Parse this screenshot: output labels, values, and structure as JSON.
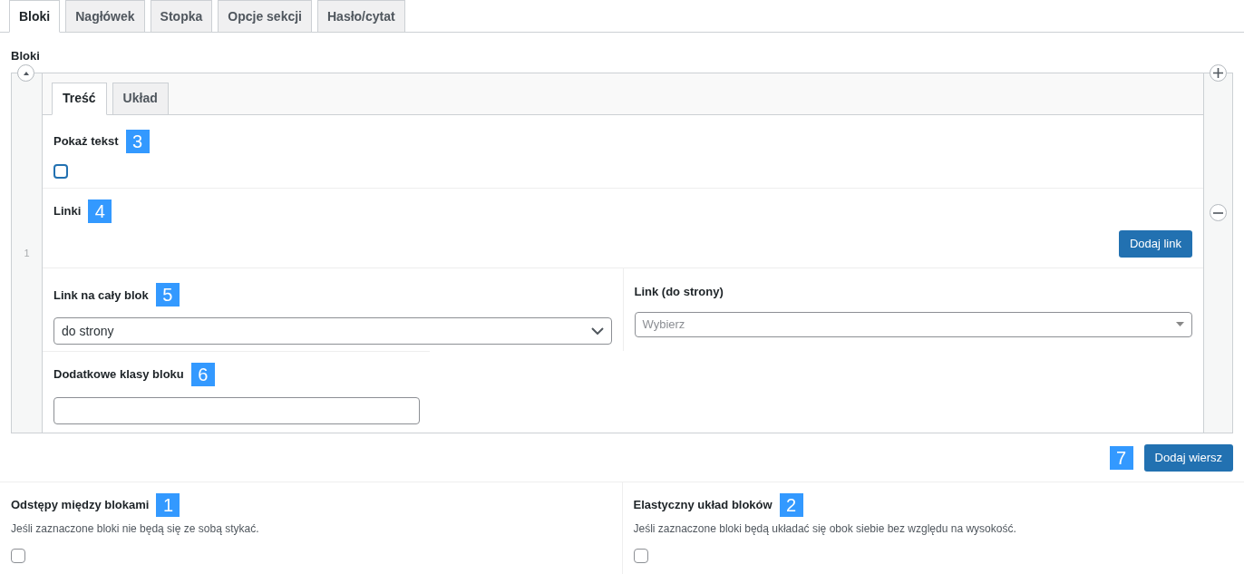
{
  "tabs": [
    {
      "label": "Bloki",
      "selected": true
    },
    {
      "label": "Nagłówek",
      "selected": false
    },
    {
      "label": "Stopka",
      "selected": false
    },
    {
      "label": "Opcje sekcji",
      "selected": false
    },
    {
      "label": "Hasło/cytat",
      "selected": false
    }
  ],
  "section_label": "Bloki",
  "repeater": {
    "row_number": "1",
    "tabs": [
      {
        "label": "Treść",
        "selected": true
      },
      {
        "label": "Układ",
        "selected": false
      }
    ],
    "fields": [
      {
        "kind": "checkbox",
        "label": "Pokaż tekst",
        "marker": "3",
        "checked": false
      },
      {
        "kind": "links",
        "label": "Linki",
        "marker": "4",
        "button": "Dodaj link"
      },
      {
        "kind": "pair",
        "columns": [
          {
            "kind": "select",
            "label": "Link na cały blok",
            "marker": "5",
            "value": "do strony"
          },
          {
            "kind": "combobox",
            "label": "Link (do strony)",
            "placeholder": "Wybierz"
          }
        ]
      },
      {
        "kind": "text",
        "label": "Dodatkowe klasy bloku",
        "marker": "6"
      }
    ]
  },
  "add_row": {
    "marker": "7",
    "button": "Dodaj wiersz"
  },
  "options": [
    {
      "label": "Odstępy między blokami",
      "marker": "1",
      "description": "Jeśli zaznaczone bloki nie będą się ze sobą stykać.",
      "checked": false
    },
    {
      "label": "Elastyczny układ bloków",
      "marker": "2",
      "description": "Jeśli zaznaczone bloki będą układać się obok siebie bez względu na wysokość.",
      "checked": false
    }
  ]
}
